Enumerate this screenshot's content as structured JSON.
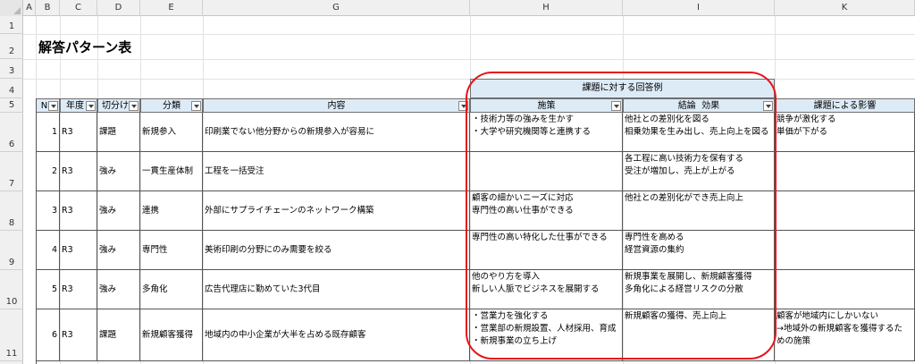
{
  "sheet": {
    "title": "解答パターン表",
    "columns": [
      "A",
      "B",
      "C",
      "D",
      "E",
      "G",
      "H",
      "I",
      "K"
    ],
    "rows": [
      "1",
      "2",
      "3",
      "4",
      "5",
      "6",
      "7",
      "8",
      "9",
      "10",
      "11"
    ]
  },
  "table": {
    "group_header": "課題に対する回答例",
    "headers": {
      "no": "N",
      "year": "年度",
      "cut": "切分け",
      "category": "分類",
      "content": "内容",
      "measures": "施策",
      "conclusion": "結論  効果",
      "impact": "課題による影響"
    },
    "rows": [
      {
        "no": "1",
        "year": "R3",
        "cut": "課題",
        "category": "新規参入",
        "content": "印刷業でない他分野からの新規参入が容易に",
        "measures": [
          "・技術力等の強みを生かす",
          "・大学や研究機関等と連携する"
        ],
        "conclusion": [
          "他社との差別化を図る",
          "相乗効果を生み出し、売上向上を図る"
        ],
        "impact": [
          "競争が激化する",
          "単価が下がる"
        ]
      },
      {
        "no": "2",
        "year": "R3",
        "cut": "強み",
        "category": "一貫生産体制",
        "content": "工程を一括受注",
        "measures": [],
        "conclusion": [
          "各工程に高い技術力を保有する",
          "受注が増加し、売上が上がる"
        ],
        "impact": []
      },
      {
        "no": "3",
        "year": "R3",
        "cut": "強み",
        "category": "連携",
        "content": "外部にサプライチェーンのネットワーク構築",
        "measures": [
          "顧客の細かいニーズに対応",
          "専門性の高い仕事ができる"
        ],
        "conclusion": [
          "他社との差別化ができ売上向上"
        ],
        "impact": []
      },
      {
        "no": "4",
        "year": "R3",
        "cut": "強み",
        "category": "専門性",
        "content": "美術印刷の分野にのみ需要を絞る",
        "measures": [
          "専門性の高い特化した仕事ができる"
        ],
        "conclusion": [
          "専門性を高める",
          "経営資源の集約"
        ],
        "impact": []
      },
      {
        "no": "5",
        "year": "R3",
        "cut": "強み",
        "category": "多角化",
        "content": "広告代理店に勤めていた3代目",
        "measures": [
          "他のやり方を導入",
          "新しい人脈でビジネスを展開する"
        ],
        "conclusion": [
          "新規事業を展開し、新規顧客獲得",
          "多角化による経営リスクの分散"
        ],
        "impact": []
      },
      {
        "no": "6",
        "year": "R3",
        "cut": "課題",
        "category": "新規顧客獲得",
        "content": "地域内の中小企業が大半を占める既存顧客",
        "measures": [
          "・営業力を強化する",
          "・営業部の新規設置、人材採用、育成",
          "・新規事業の立ち上げ"
        ],
        "conclusion": [
          "新規顧客の獲得、売上向上"
        ],
        "impact": [
          "顧客が地域内にしかいない",
          "→地域外の新規顧客を獲得するた",
          "めの施策"
        ]
      }
    ]
  },
  "colors": {
    "header_fill": "#ddebf7",
    "highlight_oval": "#e8141b",
    "grid": "#e2e2e2"
  }
}
